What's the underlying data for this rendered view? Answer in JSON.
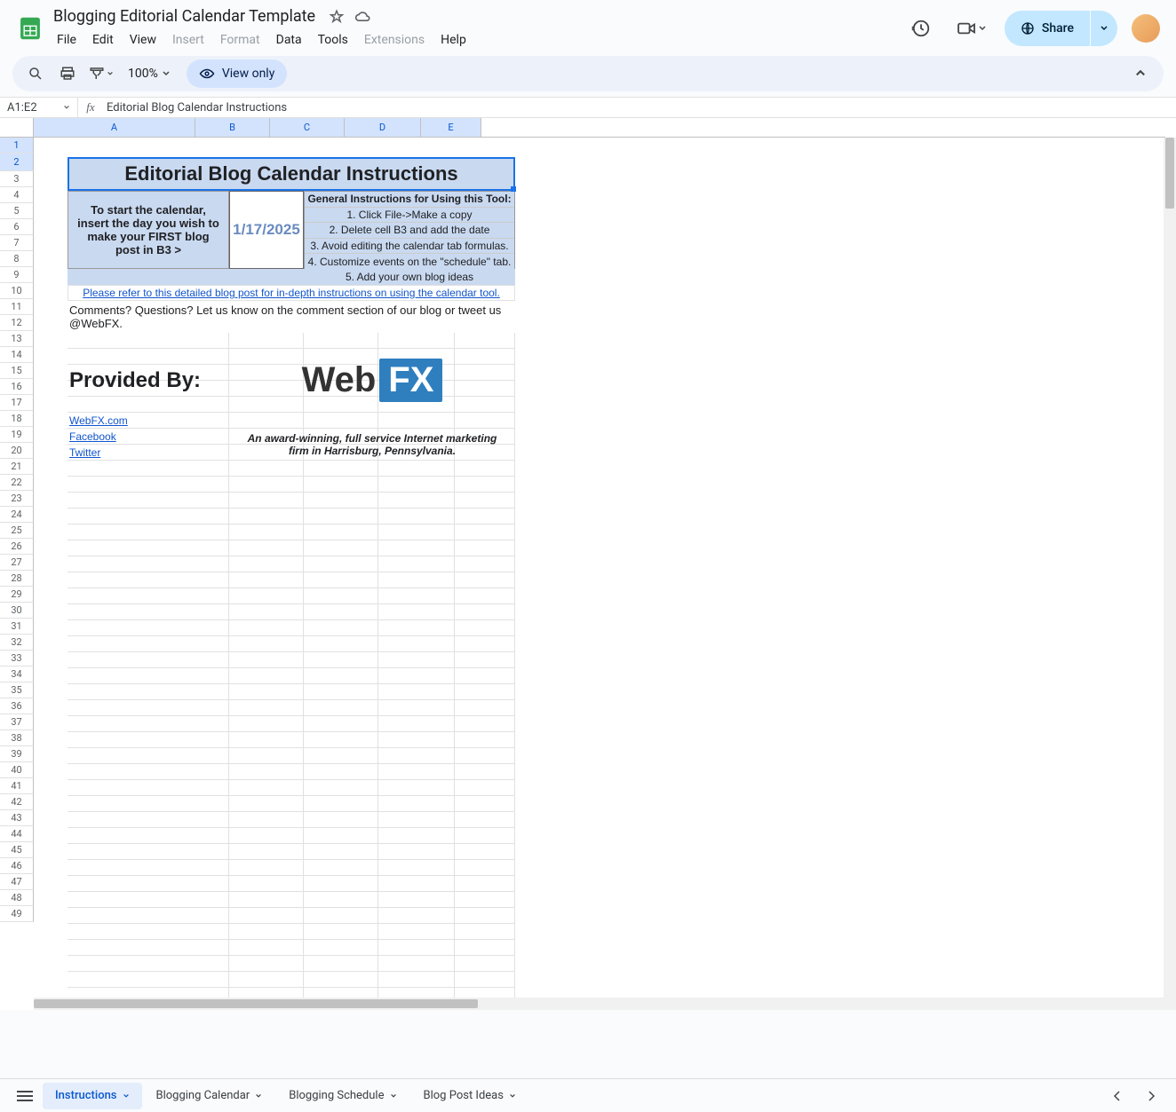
{
  "doc": {
    "title": "Blogging Editorial Calendar Template"
  },
  "menus": [
    "File",
    "Edit",
    "View",
    "Insert",
    "Format",
    "Data",
    "Tools",
    "Extensions",
    "Help"
  ],
  "menus_disabled": [
    "Insert",
    "Format",
    "Extensions"
  ],
  "toolbar": {
    "zoom": "100%",
    "view_only": "View only"
  },
  "share": {
    "label": "Share"
  },
  "name_box": "A1:E2",
  "formula": "Editorial Blog Calendar Instructions",
  "columns": [
    "A",
    "B",
    "C",
    "D",
    "E"
  ],
  "rows": [
    "1",
    "2",
    "3",
    "4",
    "5",
    "6",
    "7",
    "8",
    "9",
    "10",
    "11",
    "12",
    "13",
    "14",
    "15",
    "16",
    "17",
    "18",
    "19",
    "20",
    "21",
    "22",
    "23",
    "24",
    "25",
    "26",
    "27",
    "28",
    "29",
    "30",
    "31",
    "32",
    "33",
    "34",
    "35",
    "36",
    "37",
    "38",
    "39",
    "40",
    "41",
    "42",
    "43",
    "44",
    "45",
    "46",
    "47",
    "48",
    "49"
  ],
  "cells": {
    "title": "Editorial Blog Calendar Instructions",
    "start_instruction": "To start the calendar, insert the day you wish to make your FIRST blog post in B3 >",
    "date": "1/17/2025",
    "general_header": "General Instructions for Using this Tool:",
    "general": [
      "1. Click File->Make a copy",
      "2. Delete cell B3 and add the date",
      "3. Avoid editing the calendar tab formulas.",
      "4. Customize events on the \"schedule\" tab.",
      "5. Add your own blog ideas"
    ],
    "detail_link": "Please refer to this detailed blog post for in-depth instructions on using the calendar tool.",
    "comments": "Comments? Questions? Let us know on the comment section of our blog or tweet us @WebFX.",
    "provided_by": "Provided By:",
    "logo_text_web": "Web",
    "logo_text_fx": "FX",
    "links": [
      "WebFX.com",
      "Facebook",
      "Twitter"
    ],
    "tagline": "An award-winning, full service Internet marketing firm in Harrisburg, Pennsylvania."
  },
  "sheets": [
    {
      "name": "Instructions",
      "active": true
    },
    {
      "name": "Blogging Calendar",
      "active": false
    },
    {
      "name": "Blogging Schedule",
      "active": false
    },
    {
      "name": "Blog Post Ideas",
      "active": false
    }
  ]
}
